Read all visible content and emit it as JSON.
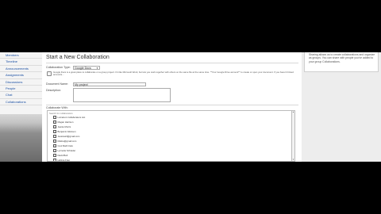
{
  "sidebar": {
    "items": [
      {
        "label": "Members"
      },
      {
        "label": "Timeline"
      },
      {
        "label": "Announcements"
      },
      {
        "label": "Assignments"
      },
      {
        "label": "Discussions"
      },
      {
        "label": "People"
      },
      {
        "label": "Chat"
      },
      {
        "label": "Collaborations"
      }
    ]
  },
  "main": {
    "title": "Start a New Collaboration",
    "collaboration_type_label": "Collaboration Type:",
    "collaboration_type_value": "Google Docs",
    "info_text": "Google Docs is a great place to collaborate on a group project. It's like Microsoft Word, but lets you work together with others on the same file at the same time. **Your Google Drive account** to create or open your document. If you haven't linked accounts...",
    "document_name_label": "Document Name:",
    "document_name_value": "My project",
    "description_label": "Description:",
    "collaborate_with_label": "Collaborate With:",
    "list_header": "Search for collaborators",
    "collaborators": [
      "Lorraine's Collaborators List",
      "Megan Harrison",
      "Jeanie Morris",
      "Benjamin Atkinson",
      "Jessicas3@gmail.com",
      "Melina@gmail.com",
      "Cool Math Cats",
      "Lynnette Schrader",
      "David Bell",
      "Hebina Frag"
    ]
  },
  "right_panel": {
    "note": "Sharing allows us to create collaborations and organize as groups. You can share with people you've added to your group Collaborations."
  }
}
